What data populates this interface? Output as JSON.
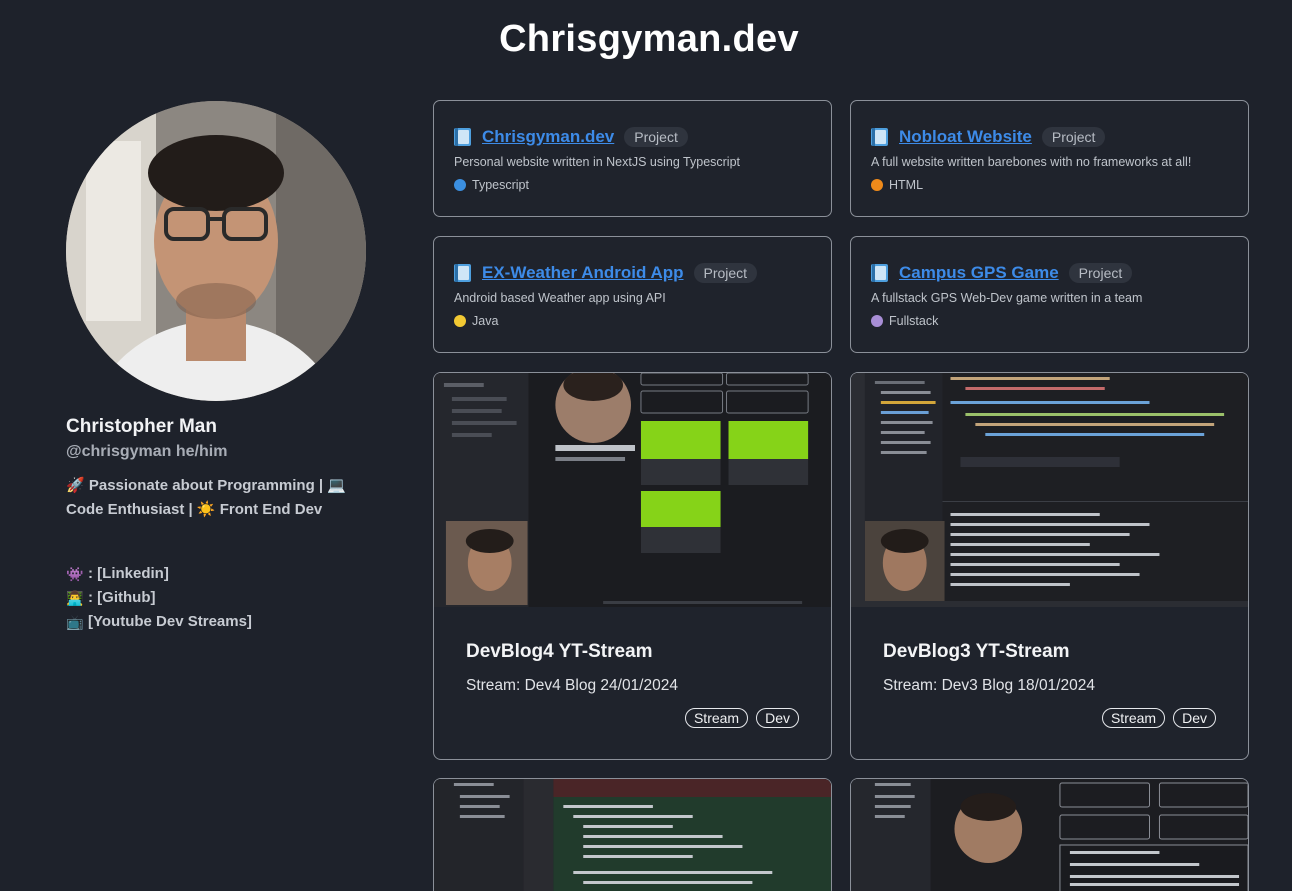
{
  "site": {
    "title": "Chrisgyman.dev"
  },
  "profile": {
    "name": "Christopher Man",
    "handle": "@chrisgyman he/him",
    "bio_line1_text": "Passionate about Programming |",
    "bio_line2_text": "Code Enthusiast |",
    "bio_line2_end": "Front End Dev",
    "bio_icons": {
      "rocket": "🚀",
      "laptop": "💻",
      "sun": "☀️"
    },
    "links": [
      {
        "icon": "👾",
        "icon_name": "space-invader-icon",
        "label": ": [Linkedin]"
      },
      {
        "icon": "👨‍💻",
        "icon_name": "technologist-icon",
        "label": ": [Github]"
      },
      {
        "icon": "📺",
        "icon_name": "television-icon",
        "label": " [Youtube Dev Streams]"
      }
    ]
  },
  "repos": [
    {
      "name": "Chrisgyman.dev",
      "badge": "Project",
      "description": "Personal website written in NextJS using Typescript",
      "language": "Typescript",
      "lang_color": "#3b8fe0"
    },
    {
      "name": "Nobloat Website",
      "badge": "Project",
      "description": "A full website written barebones with no frameworks at all!",
      "language": "HTML",
      "lang_color": "#ef8a1a"
    },
    {
      "name": "EX-Weather Android App",
      "badge": "Project",
      "description": "Android based Weather app using API",
      "language": "Java",
      "lang_color": "#f2c933"
    },
    {
      "name": "Campus GPS Game",
      "badge": "Project",
      "description": "A fullstack GPS Web-Dev game written in a team",
      "language": "Fullstack",
      "lang_color": "#a88ed6"
    }
  ],
  "blogs": [
    {
      "title": "DevBlog4 YT-Stream",
      "subtitle": "Stream: Dev4 Blog 24/01/2024",
      "tags": [
        "Stream",
        "Dev"
      ]
    },
    {
      "title": "DevBlog3 YT-Stream",
      "subtitle": "Stream: Dev3 Blog 18/01/2024",
      "tags": [
        "Stream",
        "Dev"
      ]
    }
  ],
  "colors": {
    "background": "#1e222b",
    "link": "#3d8be8",
    "card_border": "#8b9099"
  }
}
